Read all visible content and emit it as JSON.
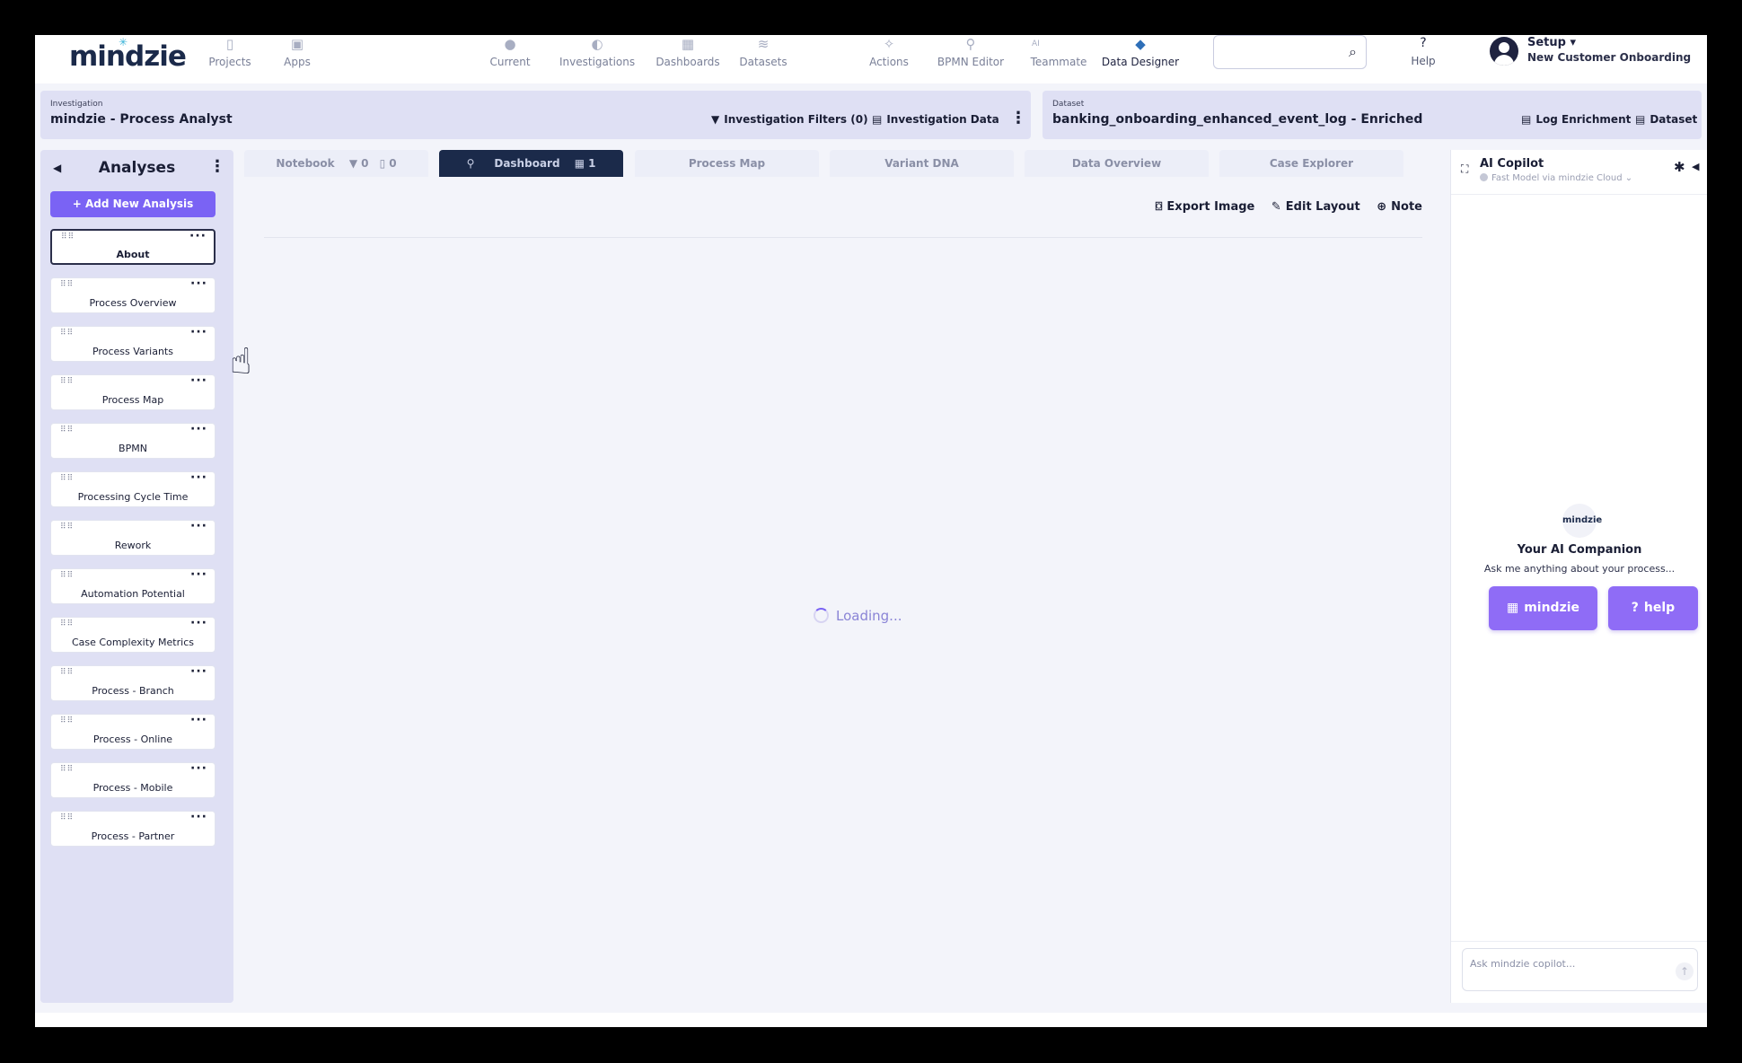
{
  "brand": {
    "name": "mindzie"
  },
  "nav": [
    {
      "label": "Projects",
      "icon": "document-icon"
    },
    {
      "label": "Apps",
      "icon": "apps-icon"
    },
    {
      "label": "Current",
      "icon": "location-icon"
    },
    {
      "label": "Investigations",
      "icon": "moon-icon"
    },
    {
      "label": "Dashboards",
      "icon": "grid-icon"
    },
    {
      "label": "Datasets",
      "icon": "database-icon"
    },
    {
      "label": "Actions",
      "icon": "actions-icon"
    },
    {
      "label": "BPMN Editor",
      "icon": "bpmn-icon"
    },
    {
      "label": "Teammate",
      "prefix": "AI",
      "icon": "chat-icon"
    },
    {
      "label": "Data Designer",
      "icon": "cube-icon"
    }
  ],
  "search": {
    "placeholder": "",
    "icon": "search-icon"
  },
  "help": {
    "label": "Help",
    "icon": "question-icon"
  },
  "user": {
    "menu_label": "Setup",
    "org": "New Customer Onboarding"
  },
  "investigation": {
    "label": "Investigation",
    "name": "mindzie - Process Analyst",
    "filters_label": "Investigation Filters (0)",
    "data_label": "Investigation Data"
  },
  "dataset": {
    "label": "Dataset",
    "name": "banking_onboarding_enhanced_event_log - Enriched",
    "enrichment_label": "Log Enrichment",
    "dataset_label": "Dataset"
  },
  "analyses": {
    "title": "Analyses",
    "add_label": "Add New Analysis",
    "items": [
      {
        "label": "About",
        "active": true
      },
      {
        "label": "Process Overview"
      },
      {
        "label": "Process Variants"
      },
      {
        "label": "Process Map"
      },
      {
        "label": "BPMN"
      },
      {
        "label": "Processing Cycle Time"
      },
      {
        "label": "Rework"
      },
      {
        "label": "Automation Potential"
      },
      {
        "label": "Case Complexity Metrics"
      },
      {
        "label": "Process - Branch"
      },
      {
        "label": "Process - Online"
      },
      {
        "label": "Process - Mobile"
      },
      {
        "label": "Process - Partner"
      }
    ]
  },
  "tabs": {
    "notebook": {
      "label": "Notebook",
      "filters": "0",
      "notes": "0"
    },
    "dashboard": {
      "label": "Dashboard",
      "count": "1"
    },
    "process_map": "Process Map",
    "variant_dna": "Variant DNA",
    "data_overview": "Data Overview",
    "case_explorer": "Case Explorer"
  },
  "toolbar": {
    "export": "Export Image",
    "edit": "Edit Layout",
    "note": "Note"
  },
  "main": {
    "loading": "Loading..."
  },
  "copilot": {
    "title": "AI Copilot",
    "model": "Fast Model via mindzie Cloud",
    "logo": "mindzie",
    "heading": "Your AI Companion",
    "subtitle": "Ask me anything about your process...",
    "btn_mindzie": "mindzie",
    "btn_help": "help",
    "input_placeholder": "Ask mindzie copilot..."
  },
  "colors": {
    "accent": "#7a63f4",
    "navy": "#1b2a4a",
    "panel": "#dfe0f4"
  }
}
